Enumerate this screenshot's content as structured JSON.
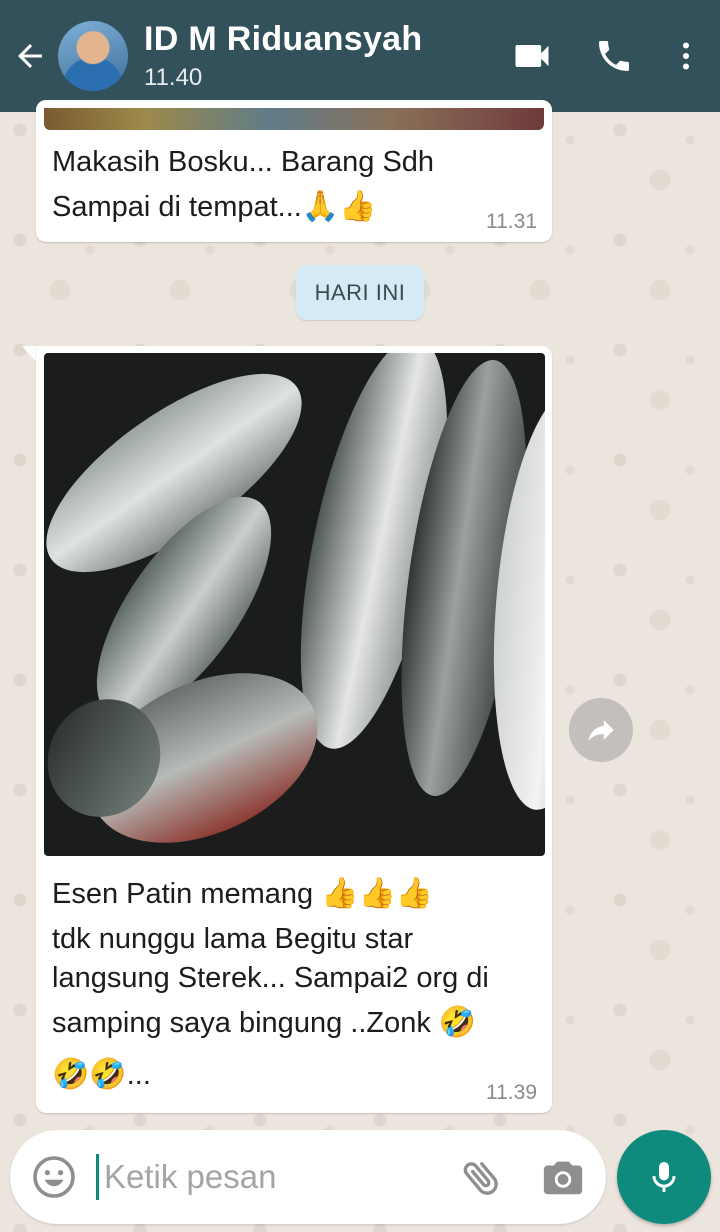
{
  "header": {
    "contact_name": "ID M Riduansyah",
    "status": "11.40",
    "icons": [
      "back-arrow-icon",
      "video-call-icon",
      "phone-icon",
      "more-vertical-icon"
    ],
    "color": "#33515a"
  },
  "messages": [
    {
      "line1": "Makasih Bosku... Barang Sdh",
      "line2": "Sampai di tempat...",
      "emojis": "🙏👍",
      "time": "11.31"
    },
    {
      "line1": "Esen Patin memang",
      "line1_emojis": "👍👍👍",
      "line2": "tdk nunggu lama Begitu star",
      "line3": "langsung Sterek... Sampai2 org di",
      "line4": "samping saya bingung ..Zonk",
      "line4_emoji": "🤣",
      "line5_emojis": "🤣🤣",
      "line5_text": "...",
      "time": "11.39"
    }
  ],
  "date_chip": "HARI INI",
  "input": {
    "placeholder": "Ketik pesan"
  },
  "accent_color": "#0f8b7d"
}
